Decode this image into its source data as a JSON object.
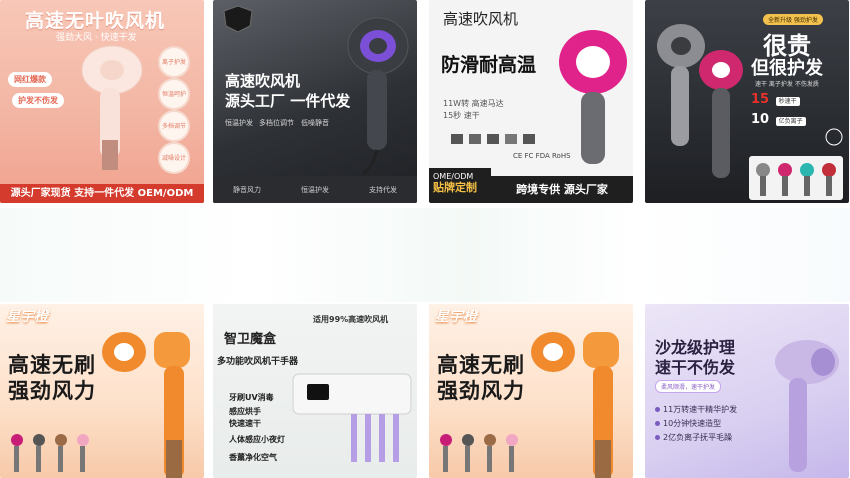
{
  "tiles": [
    {
      "title": "高速无叶吹风机",
      "subtitle": "强劲大风 · 快速干发",
      "pills": [
        "网红爆款",
        "护发不伤发"
      ],
      "circles": [
        "离子护发",
        "恒温呵护",
        "多档调节",
        "减噪设计"
      ],
      "bar": "源头厂家现货 支持一件代发 OEM/ODM"
    },
    {
      "title_line1": "高速吹风机",
      "title_line2": "源头工厂 一件代发",
      "small": [
        "恒温护发",
        "多档位调节",
        "低噪静音"
      ],
      "bottom": [
        "静音风力",
        "恒温护发",
        "支持代发"
      ]
    },
    {
      "title": "高速吹风机",
      "title2": "防滑耐高温",
      "specs": [
        "11W转 高速马达",
        "15秒 速干"
      ],
      "logos": "CE FC FDA RoHS",
      "bottom_left": [
        "OME/ODM",
        "贴牌定制"
      ],
      "bottom_right": "跨境专供 源头厂家"
    },
    {
      "badge": "全新升级 强劲护发",
      "big1": "很贵",
      "big2": "但很护发",
      "mini": "速干 离子护发 不伤发质",
      "stats": [
        {
          "num": "15",
          "label": "秒速干"
        },
        {
          "num": "10",
          "label": "亿负离子"
        }
      ]
    },
    {
      "brand": "星宇橙",
      "line1": "高速无刷",
      "line2": "强劲风力"
    },
    {
      "top": "适用99%高速吹风机",
      "brand": "智卫魔盒",
      "sub": "多功能吹风机干手器",
      "features": [
        "牙刷UV消毒",
        "感应烘手",
        "快速速干",
        "人体感应小夜灯",
        "香薰净化空气"
      ]
    },
    {
      "brand": "星宇橙",
      "line1": "高速无刷",
      "line2": "强劲风力"
    },
    {
      "title_line1": "沙龙级护理",
      "title_line2": "速干不伤发",
      "tag": "柔风顺滑，速干护发",
      "items": [
        "11万转速干精华护发",
        "10分钟快速造型",
        "2亿负离子抚平毛躁"
      ]
    }
  ],
  "colors": {
    "accent_red": "#d43b2c",
    "accent_orange": "#f08a2c",
    "accent_purple": "#7b5bbf"
  }
}
